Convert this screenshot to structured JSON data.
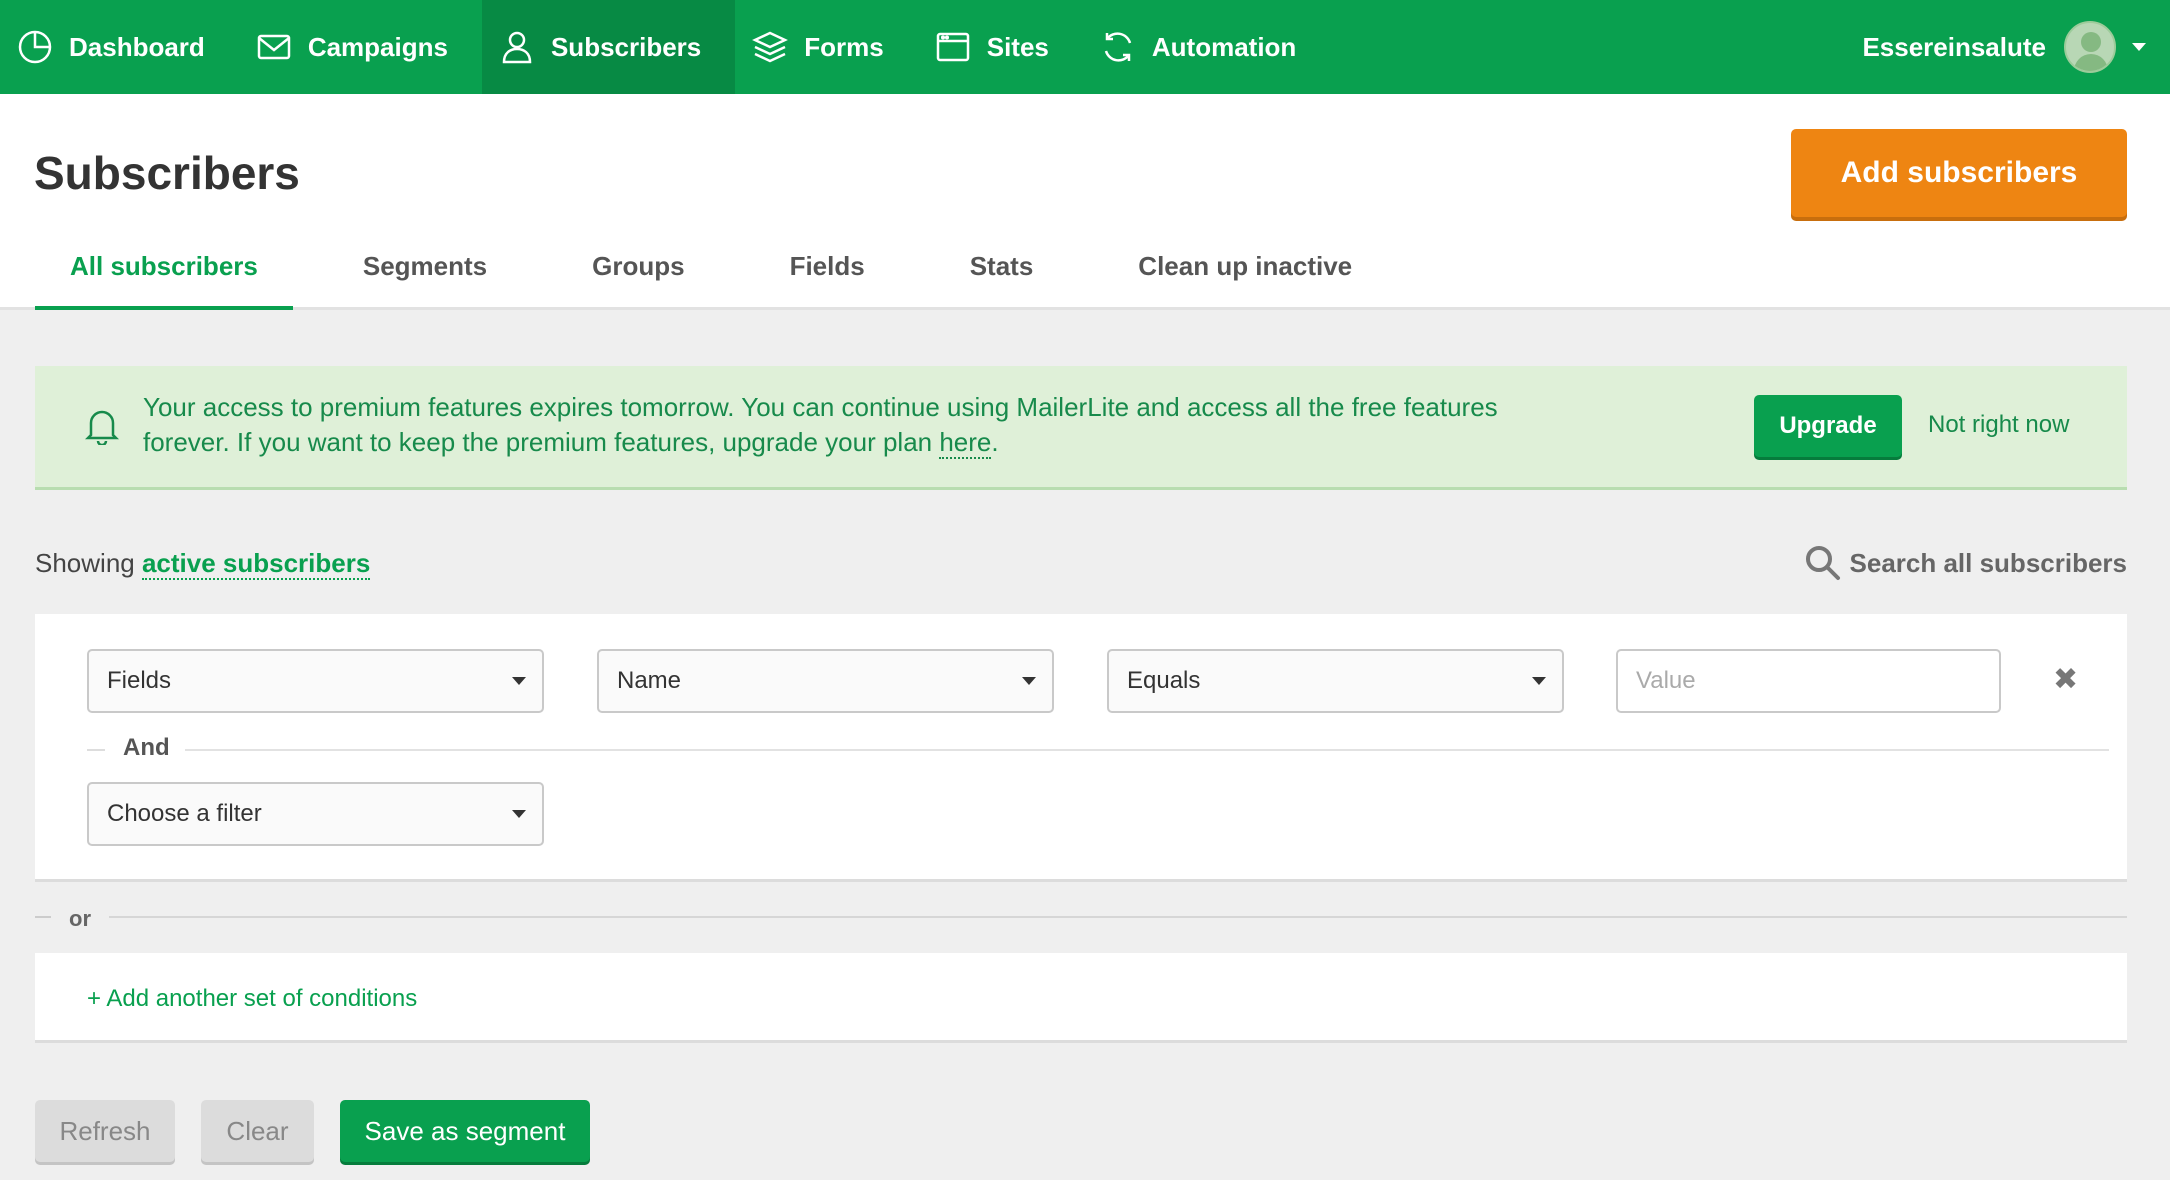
{
  "nav": {
    "items": [
      {
        "label": "Dashboard",
        "icon": "dashboard-icon"
      },
      {
        "label": "Campaigns",
        "icon": "envelope-icon"
      },
      {
        "label": "Subscribers",
        "icon": "user-icon"
      },
      {
        "label": "Forms",
        "icon": "layers-icon"
      },
      {
        "label": "Sites",
        "icon": "browser-window-icon"
      },
      {
        "label": "Automation",
        "icon": "refresh-cycle-icon"
      }
    ],
    "active": "Subscribers",
    "username": "Essereinsalute"
  },
  "header": {
    "title": "Subscribers",
    "add_button": "Add subscribers",
    "tabs": [
      {
        "label": "All subscribers"
      },
      {
        "label": "Segments"
      },
      {
        "label": "Groups"
      },
      {
        "label": "Fields"
      },
      {
        "label": "Stats"
      },
      {
        "label": "Clean up inactive"
      }
    ],
    "active_tab": "All subscribers"
  },
  "banner": {
    "text": "Your access to premium features expires tomorrow. You can continue using MailerLite and access all the free features forever. If you want to keep the premium features, upgrade your plan ",
    "link": "here",
    "suffix": ".",
    "upgrade_button": "Upgrade",
    "dismiss": "Not right now"
  },
  "showing": {
    "prefix": "Showing",
    "link": "active subscribers",
    "search_label": "Search all subscribers"
  },
  "filters": {
    "condition": {
      "field_type": "Fields",
      "field": "Name",
      "operator": "Equals",
      "value_placeholder": "Value"
    },
    "and_label": "And",
    "choose_filter": "Choose a filter",
    "or_label": "or",
    "add_conditions": "+ Add another set of conditions"
  },
  "actions": {
    "refresh": "Refresh",
    "clear": "Clear",
    "save_segment": "Save as segment"
  },
  "colors": {
    "brand_green": "#09a04f",
    "accent_orange": "#ee8512",
    "banner_bg": "#dff0d8"
  }
}
